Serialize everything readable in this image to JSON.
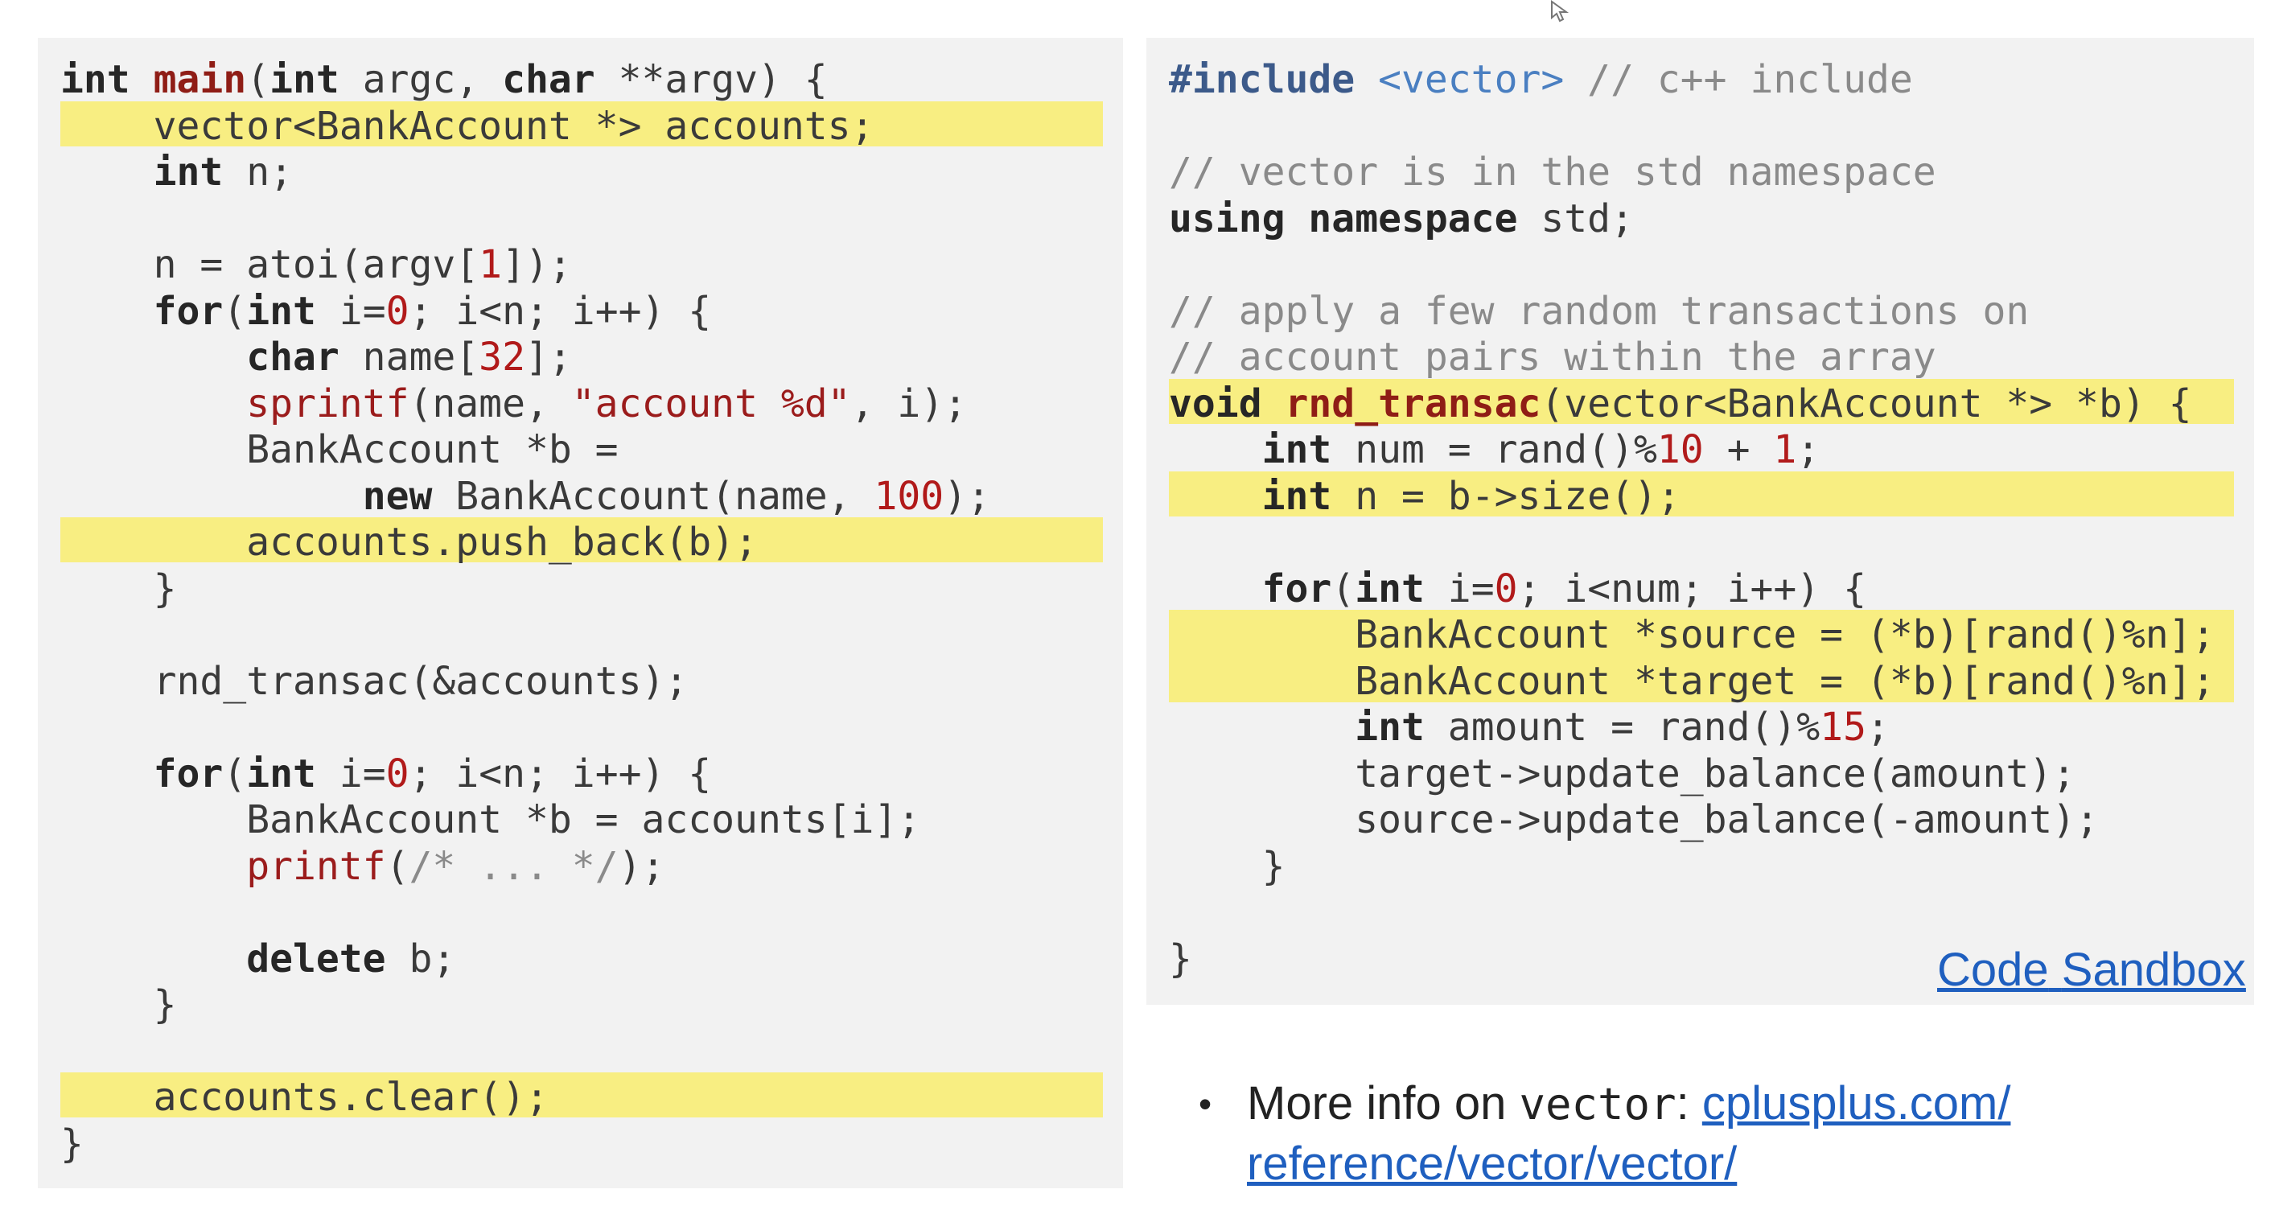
{
  "left_code": {
    "l1_kw": "int",
    "l1_fn": "main",
    "l1_a": "(",
    "l1_kw2": "int",
    "l1_b": " argc, ",
    "l1_kw3": "char",
    "l1_c": " **argv) {",
    "l2": "    vector<BankAccount *> accounts;",
    "l3_kw": "int",
    "l3_rest": " n;",
    "l5_a": "    n = atoi(argv[",
    "l5_num": "1",
    "l5_b": "]);",
    "l6_kw": "for",
    "l6_a": "(",
    "l6_kw2": "int",
    "l6_b": " i=",
    "l6_num": "0",
    "l6_c": "; i<n; i++) {",
    "l7_kw": "char",
    "l7_a": " name[",
    "l7_num": "32",
    "l7_b": "];",
    "l8_a": "sprintf",
    "l8_b": "(name, ",
    "l8_str": "\"account %d\"",
    "l8_c": ", i);",
    "l9": "        BankAccount *b =",
    "l10_kw": "new",
    "l10_a": " BankAccount(name, ",
    "l10_num": "100",
    "l10_b": ");",
    "l11": "        accounts.push_back(b);",
    "l12": "    }",
    "l14": "    rnd_transac(&accounts);",
    "l16_kw": "for",
    "l16_a": "(",
    "l16_kw2": "int",
    "l16_b": " i=",
    "l16_num": "0",
    "l16_c": "; i<n; i++) {",
    "l17": "        BankAccount *b = accounts[i];",
    "l18_a": "printf",
    "l18_b": "(",
    "l18_cm": "/* ... */",
    "l18_c": ");",
    "l20_kw": "delete",
    "l20_a": " b;",
    "l21": "    }",
    "l23": "    accounts.clear();",
    "l24": "}"
  },
  "right_code": {
    "r1_pp": "#include",
    "r1_inc": " <vector>",
    "r1_cm": " // c++ include",
    "r3_cm": "// vector is in the std namespace",
    "r4_kw": "using namespace",
    "r4_rest": " std;",
    "r6_cm": "// apply a few random transactions on",
    "r7_cm": "// account pairs within the array",
    "r8_kw": "void",
    "r8_fn": "rnd_transac",
    "r8_rest": "(vector<BankAccount *> *b) {",
    "r9_kw": "int",
    "r9_a": " num = rand()%",
    "r9_num": "10",
    "r9_b": " + ",
    "r9_num2": "1",
    "r9_c": ";",
    "r10_kw": "int",
    "r10_rest": " n = b->size();",
    "r12_kw": "for",
    "r12_a": "(",
    "r12_kw2": "int",
    "r12_b": " i=",
    "r12_num": "0",
    "r12_c": "; i<num; i++) {",
    "r13": "        BankAccount *source = (*b)[rand()%n];",
    "r14": "        BankAccount *target = (*b)[rand()%n];",
    "r15_kw": "int",
    "r15_a": " amount = rand()%",
    "r15_num": "15",
    "r15_b": ";",
    "r16": "        target->update_balance(amount);",
    "r17": "        source->update_balance(-amount);",
    "r18": "    }",
    "r20": "}"
  },
  "links": {
    "code": "Code",
    "sandbox": "Sandbox"
  },
  "info": {
    "bullet": "•",
    "prefix": "More info on ",
    "code": "vector",
    "colon": ": ",
    "link_line1": "cplusplus.com/",
    "link_line2": "reference/vector/vector/"
  },
  "cursor_icon": "mouse-pointer-icon"
}
